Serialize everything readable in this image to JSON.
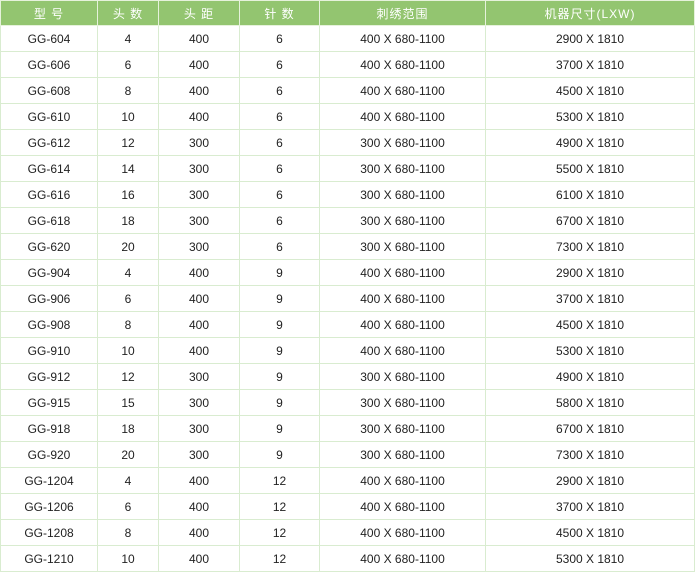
{
  "table": {
    "headers": [
      "型 号",
      "头 数",
      "头 距",
      "针 数",
      "刺绣范围",
      "机器尺寸(LXW)"
    ],
    "rows": [
      [
        "GG-604",
        "4",
        "400",
        "6",
        "400 X 680-1100",
        "2900 X 1810"
      ],
      [
        "GG-606",
        "6",
        "400",
        "6",
        "400 X 680-1100",
        "3700 X 1810"
      ],
      [
        "GG-608",
        "8",
        "400",
        "6",
        "400 X 680-1100",
        "4500 X 1810"
      ],
      [
        "GG-610",
        "10",
        "400",
        "6",
        "400 X 680-1100",
        "5300 X 1810"
      ],
      [
        "GG-612",
        "12",
        "300",
        "6",
        "300 X 680-1100",
        "4900 X 1810"
      ],
      [
        "GG-614",
        "14",
        "300",
        "6",
        "300 X 680-1100",
        "5500 X 1810"
      ],
      [
        "GG-616",
        "16",
        "300",
        "6",
        "300 X 680-1100",
        "6100 X 1810"
      ],
      [
        "GG-618",
        "18",
        "300",
        "6",
        "300 X 680-1100",
        "6700 X 1810"
      ],
      [
        "GG-620",
        "20",
        "300",
        "6",
        "300 X 680-1100",
        "7300 X 1810"
      ],
      [
        "GG-904",
        "4",
        "400",
        "9",
        "400 X 680-1100",
        "2900 X 1810"
      ],
      [
        "GG-906",
        "6",
        "400",
        "9",
        "400 X 680-1100",
        "3700 X 1810"
      ],
      [
        "GG-908",
        "8",
        "400",
        "9",
        "400 X 680-1100",
        "4500 X 1810"
      ],
      [
        "GG-910",
        "10",
        "400",
        "9",
        "400 X 680-1100",
        "5300 X 1810"
      ],
      [
        "GG-912",
        "12",
        "300",
        "9",
        "300 X 680-1100",
        "4900 X 1810"
      ],
      [
        "GG-915",
        "15",
        "300",
        "9",
        "300 X 680-1100",
        "5800 X 1810"
      ],
      [
        "GG-918",
        "18",
        "300",
        "9",
        "300 X 680-1100",
        "6700 X 1810"
      ],
      [
        "GG-920",
        "20",
        "300",
        "9",
        "300 X 680-1100",
        "7300 X 1810"
      ],
      [
        "GG-1204",
        "4",
        "400",
        "12",
        "400 X 680-1100",
        "2900 X 1810"
      ],
      [
        "GG-1206",
        "6",
        "400",
        "12",
        "400 X 680-1100",
        "3700 X 1810"
      ],
      [
        "GG-1208",
        "8",
        "400",
        "12",
        "400 X 680-1100",
        "4500 X 1810"
      ],
      [
        "GG-1210",
        "10",
        "400",
        "12",
        "400 X 680-1100",
        "5300 X 1810"
      ]
    ]
  },
  "colors": {
    "header_bg": "#93c570",
    "header_text": "#ffffff",
    "border": "#d9ecd0",
    "text": "#222222"
  }
}
